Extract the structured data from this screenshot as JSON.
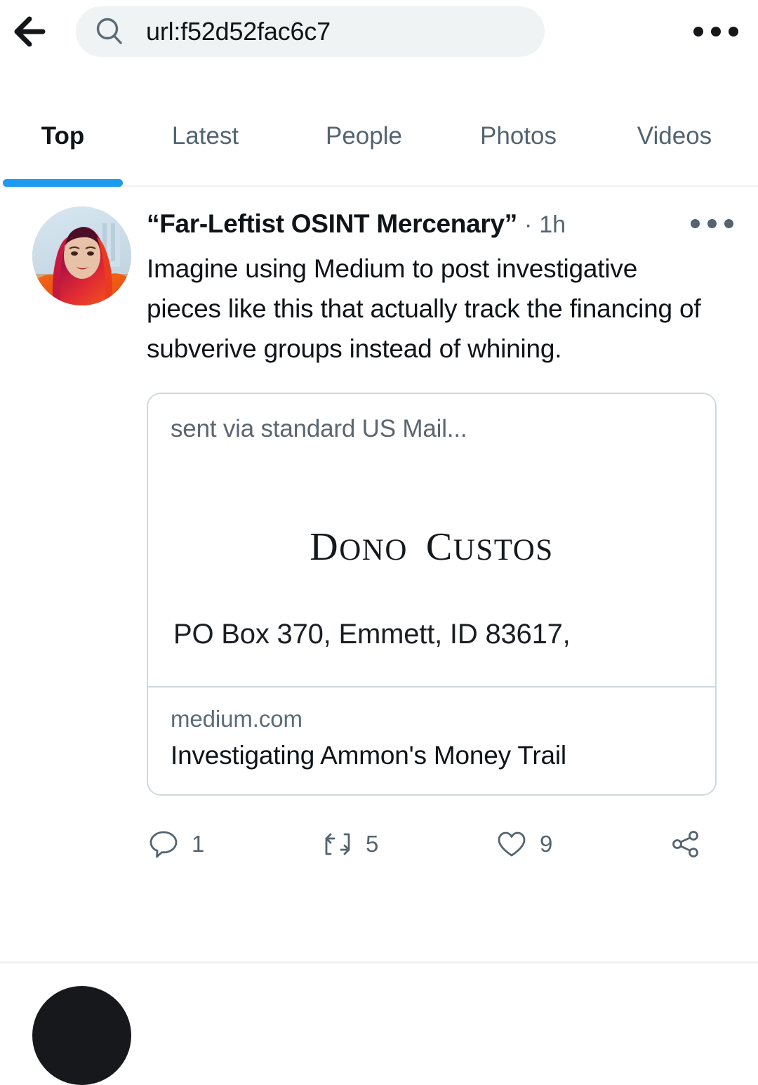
{
  "header": {
    "back_icon": "back-arrow-icon",
    "search": {
      "icon": "search-icon",
      "value": "url:f52d52fac6c7",
      "placeholder": "Search Twitter"
    },
    "more_icon": "more-horizontal-icon"
  },
  "tabs": {
    "items": [
      {
        "label": "Top",
        "active": true
      },
      {
        "label": "Latest",
        "active": false
      },
      {
        "label": "People",
        "active": false
      },
      {
        "label": "Photos",
        "active": false
      },
      {
        "label": "Videos",
        "active": false
      }
    ],
    "active_underline_color": "#1d9bf0"
  },
  "tweet": {
    "avatar_alt": "profile-photo-woman-red-hair",
    "display_name": "“Far-Leftist OSINT Mercenary”",
    "separator": "·",
    "timestamp": "1h",
    "more_icon": "more-horizontal-icon",
    "text": "Imagine using Medium to post investigative pieces like this that actually track the financing of subverive groups instead of whining.",
    "card": {
      "image_caption": "sent via standard US Mail...",
      "brand_first_cap": "D",
      "brand_first_rest": "ONO",
      "brand_second_cap": "C",
      "brand_second_rest": "USTOS",
      "brand_full": "DONO CUSTOS",
      "address": "PO Box 370, Emmett, ID 83617,",
      "domain": "medium.com",
      "title": "Investigating Ammon's Money Trail"
    },
    "actions": {
      "reply": {
        "icon": "reply-icon",
        "count": "1"
      },
      "retweet": {
        "icon": "retweet-icon",
        "count": "5"
      },
      "like": {
        "icon": "heart-icon",
        "count": "9"
      },
      "share": {
        "icon": "share-icon",
        "count": ""
      }
    }
  },
  "colors": {
    "accent": "#1d9bf0",
    "text_primary": "#0f1419",
    "text_secondary": "#536471",
    "search_bg": "#eff3f4",
    "card_border": "#cfd9de"
  }
}
